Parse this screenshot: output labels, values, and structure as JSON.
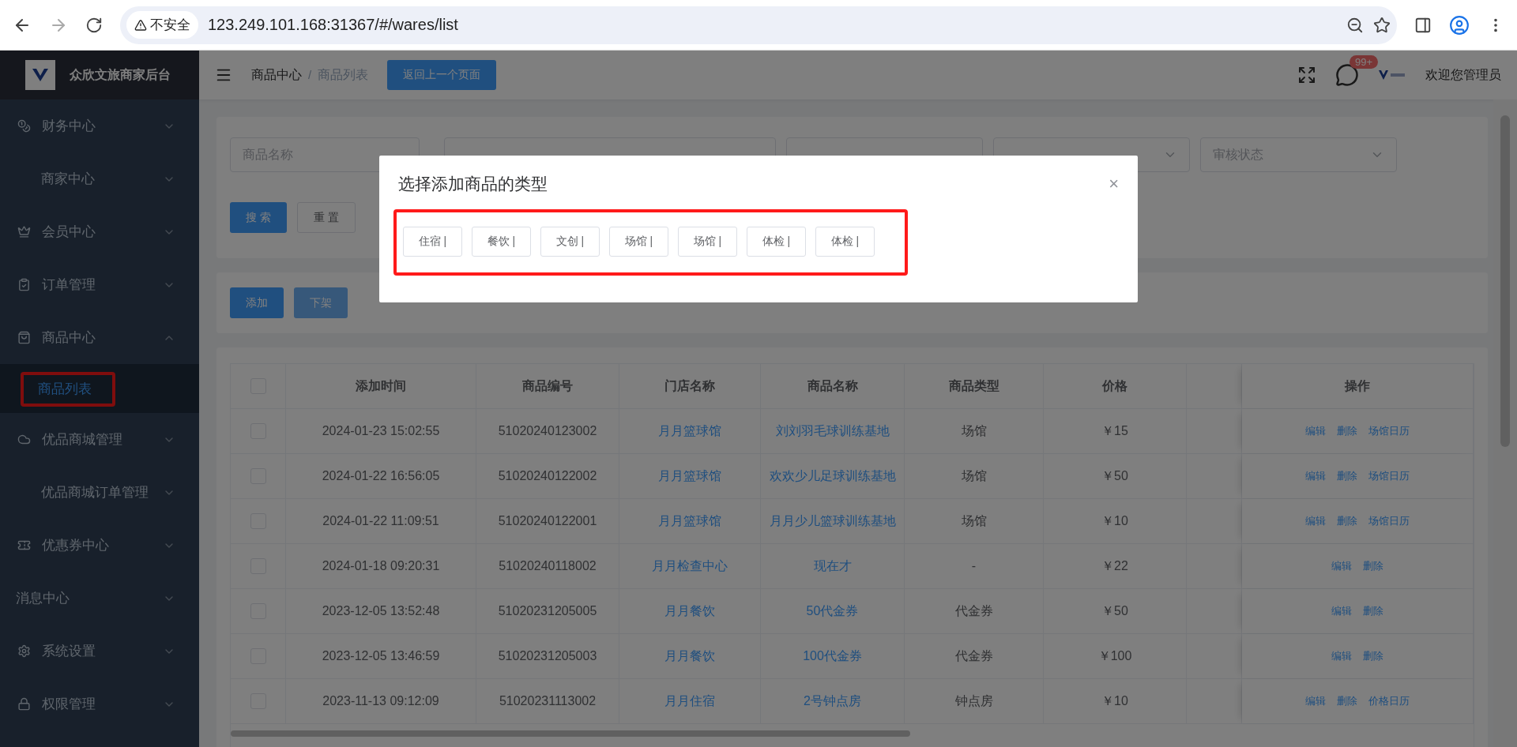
{
  "browser": {
    "security_label": "不安全",
    "url": "123.249.101.168:31367/#/wares/list"
  },
  "sidebar": {
    "title": "众欣文旅商家后台",
    "items": [
      {
        "label": "财务中心",
        "kind": "icon",
        "expanded": false
      },
      {
        "label": "商家中心",
        "kind": "indented",
        "expanded": false
      },
      {
        "label": "会员中心",
        "kind": "icon",
        "expanded": false
      },
      {
        "label": "订单管理",
        "kind": "icon",
        "expanded": false
      },
      {
        "label": "商品中心",
        "kind": "icon",
        "expanded": true,
        "children": [
          {
            "label": "商品列表",
            "selected": true,
            "highlighted": true
          }
        ]
      },
      {
        "label": "优品商城管理",
        "kind": "icon",
        "expanded": false
      },
      {
        "label": "优品商城订单管理",
        "kind": "indented",
        "expanded": false
      },
      {
        "label": "优惠券中心",
        "kind": "icon",
        "expanded": false
      },
      {
        "label": "消息中心",
        "kind": "flush",
        "expanded": false
      },
      {
        "label": "系统设置",
        "kind": "icon",
        "expanded": false
      },
      {
        "label": "权限管理",
        "kind": "icon",
        "expanded": false
      }
    ]
  },
  "header": {
    "breadcrumb": [
      "商品中心",
      "商品列表"
    ],
    "breadcrumb_separator": "/",
    "back_button": "返回上一个页面",
    "notification_badge": "99+",
    "greeting": "欢迎您管理员"
  },
  "filters": [
    {
      "kind": "text",
      "placeholder": "商品名称"
    },
    {
      "kind": "covered"
    },
    {
      "kind": "covered"
    },
    {
      "kind": "select"
    },
    {
      "kind": "select",
      "placeholder": "审核状态"
    }
  ],
  "filter_buttons": [
    {
      "label": "搜 索",
      "primary": true
    },
    {
      "label": "重 置",
      "primary": false
    }
  ],
  "actions": [
    {
      "label": "添加",
      "disabled": false
    },
    {
      "label": "下架",
      "disabled": true
    }
  ],
  "table": {
    "select_all_checked": false,
    "columns": [
      "添加时间",
      "商品编号",
      "门店名称",
      "商品名称",
      "商品类型",
      "价格",
      "",
      "操作"
    ],
    "rows": [
      {
        "checked": false,
        "time": "2024-01-23 15:02:55",
        "code": "51020240123002",
        "store": "月月篮球馆",
        "name": "刘刘羽毛球训练基地",
        "type": "场馆",
        "price": "￥15",
        "ops": [
          "编辑",
          "删除",
          "场馆日历"
        ]
      },
      {
        "checked": false,
        "time": "2024-01-22 16:56:05",
        "code": "51020240122002",
        "store": "月月篮球馆",
        "name": "欢欢少儿足球训练基地",
        "type": "场馆",
        "price": "￥50",
        "ops": [
          "编辑",
          "删除",
          "场馆日历"
        ]
      },
      {
        "checked": false,
        "time": "2024-01-22 11:09:51",
        "code": "51020240122001",
        "store": "月月篮球馆",
        "name": "月月少儿篮球训练基地",
        "type": "场馆",
        "price": "￥10",
        "ops": [
          "编辑",
          "删除",
          "场馆日历"
        ]
      },
      {
        "checked": false,
        "time": "2024-01-18 09:20:31",
        "code": "51020240118002",
        "store": "月月检查中心",
        "name": "现在才",
        "type": "-",
        "price": "￥22",
        "ops": [
          "编辑",
          "删除"
        ]
      },
      {
        "checked": false,
        "time": "2023-12-05 13:52:48",
        "code": "51020231205005",
        "store": "月月餐饮",
        "name": "50代金券",
        "type": "代金券",
        "price": "￥50",
        "ops": [
          "编辑",
          "删除"
        ]
      },
      {
        "checked": false,
        "time": "2023-12-05 13:46:59",
        "code": "51020231205003",
        "store": "月月餐饮",
        "name": "100代金券",
        "type": "代金券",
        "price": "￥100",
        "ops": [
          "编辑",
          "删除"
        ]
      },
      {
        "checked": false,
        "time": "2023-11-13 09:12:09",
        "code": "51020231113002",
        "store": "月月住宿",
        "name": "2号钟点房",
        "type": "钟点房",
        "price": "￥10",
        "ops": [
          "编辑",
          "删除",
          "价格日历"
        ]
      }
    ]
  },
  "modal": {
    "title": "选择添加商品的类型",
    "close": "×",
    "highlighted": true,
    "types": [
      "住宿 |",
      "餐饮 |",
      "文创 |",
      "场馆 |",
      "场馆 |",
      "体检 |",
      "体检 |"
    ]
  }
}
